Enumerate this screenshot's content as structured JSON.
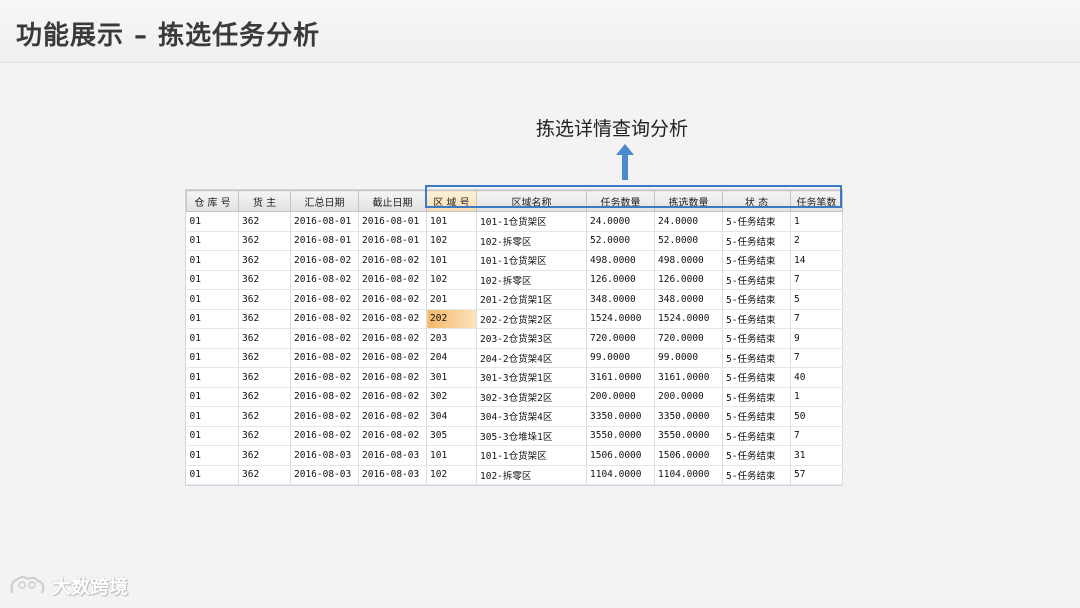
{
  "page": {
    "title": "功能展示 – 拣选任务分析",
    "annotation": "拣选详情查询分析"
  },
  "colors": {
    "highlight_box": "#3b7ac4",
    "arrow": "#4a8ad0",
    "selected_cell": "#f4b766"
  },
  "table": {
    "headers": [
      "仓 库 号",
      "货    主",
      "汇总日期",
      "截止日期",
      "区 域 号",
      "区域名称",
      "任务数量",
      "拣选数量",
      "状    态",
      "任务笔数"
    ],
    "rows": [
      [
        "01",
        "362",
        "2016-08-01",
        "2016-08-01",
        "101",
        "101-1仓货架区",
        "24.0000",
        "24.0000",
        "5-任务结束",
        "1"
      ],
      [
        "01",
        "362",
        "2016-08-01",
        "2016-08-01",
        "102",
        "102-拆零区",
        "52.0000",
        "52.0000",
        "5-任务结束",
        "2"
      ],
      [
        "01",
        "362",
        "2016-08-02",
        "2016-08-02",
        "101",
        "101-1仓货架区",
        "498.0000",
        "498.0000",
        "5-任务结束",
        "14"
      ],
      [
        "01",
        "362",
        "2016-08-02",
        "2016-08-02",
        "102",
        "102-拆零区",
        "126.0000",
        "126.0000",
        "5-任务结束",
        "7"
      ],
      [
        "01",
        "362",
        "2016-08-02",
        "2016-08-02",
        "201",
        "201-2仓货架1区",
        "348.0000",
        "348.0000",
        "5-任务结束",
        "5"
      ],
      [
        "01",
        "362",
        "2016-08-02",
        "2016-08-02",
        "202",
        "202-2仓货架2区",
        "1524.0000",
        "1524.0000",
        "5-任务结束",
        "7"
      ],
      [
        "01",
        "362",
        "2016-08-02",
        "2016-08-02",
        "203",
        "203-2仓货架3区",
        "720.0000",
        "720.0000",
        "5-任务结束",
        "9"
      ],
      [
        "01",
        "362",
        "2016-08-02",
        "2016-08-02",
        "204",
        "204-2仓货架4区",
        "99.0000",
        "99.0000",
        "5-任务结束",
        "7"
      ],
      [
        "01",
        "362",
        "2016-08-02",
        "2016-08-02",
        "301",
        "301-3仓货架1区",
        "3161.0000",
        "3161.0000",
        "5-任务结束",
        "40"
      ],
      [
        "01",
        "362",
        "2016-08-02",
        "2016-08-02",
        "302",
        "302-3仓货架2区",
        "200.0000",
        "200.0000",
        "5-任务结束",
        "1"
      ],
      [
        "01",
        "362",
        "2016-08-02",
        "2016-08-02",
        "304",
        "304-3仓货架4区",
        "3350.0000",
        "3350.0000",
        "5-任务结束",
        "50"
      ],
      [
        "01",
        "362",
        "2016-08-02",
        "2016-08-02",
        "305",
        "305-3仓堆垛1区",
        "3550.0000",
        "3550.0000",
        "5-任务结束",
        "7"
      ],
      [
        "01",
        "362",
        "2016-08-03",
        "2016-08-03",
        "101",
        "101-1仓货架区",
        "1506.0000",
        "1506.0000",
        "5-任务结束",
        "31"
      ],
      [
        "01",
        "362",
        "2016-08-03",
        "2016-08-03",
        "102",
        "102-拆零区",
        "1104.0000",
        "1104.0000",
        "5-任务结束",
        "57"
      ]
    ]
  },
  "logo": {
    "text": "大数跨境",
    "icon": "mascot-icon"
  }
}
